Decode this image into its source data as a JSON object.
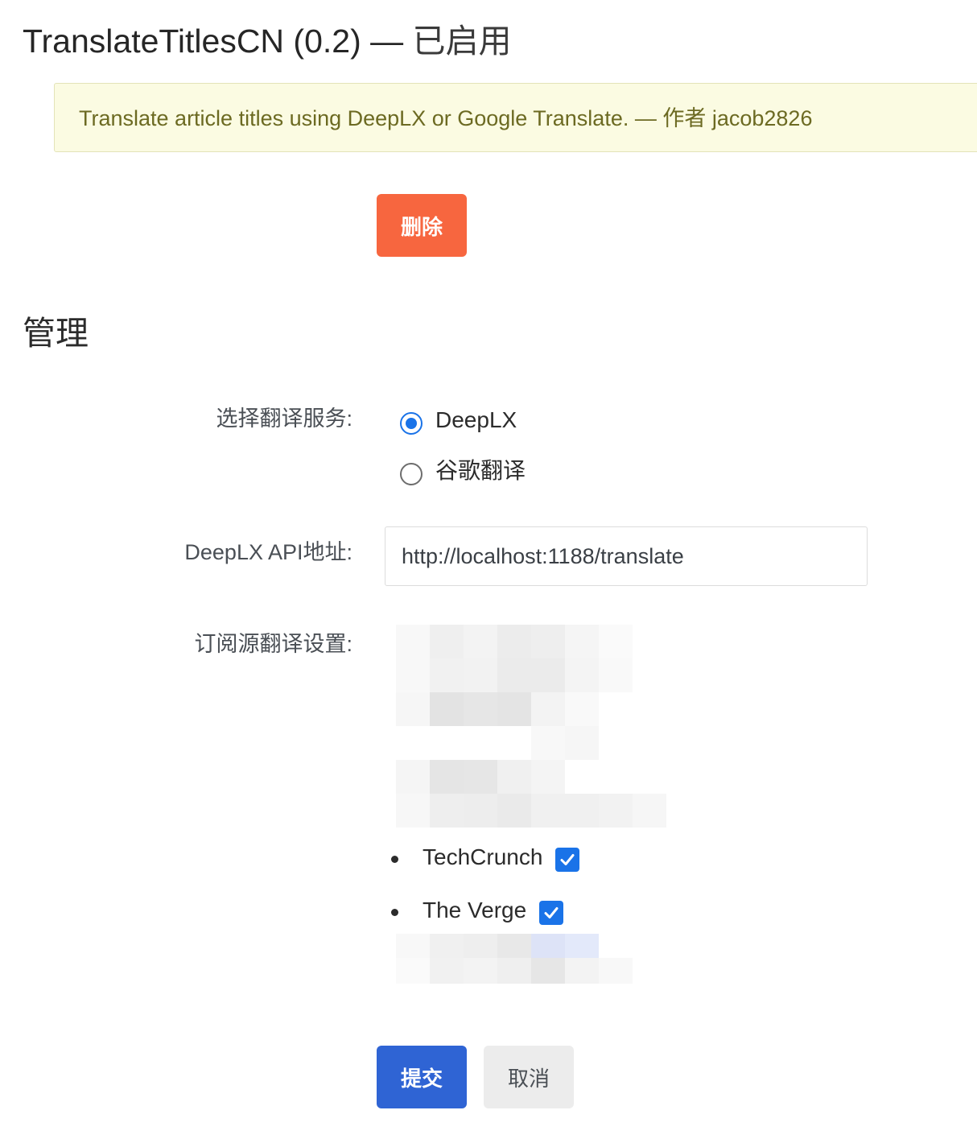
{
  "extension": {
    "name": "TranslateTitlesCN (0.2)",
    "separator": "—",
    "state": "已启用",
    "description": "Translate article titles using DeepLX or Google Translate. — 作者 jacob2826"
  },
  "actions": {
    "delete_label": "删除",
    "submit_label": "提交",
    "cancel_label": "取消"
  },
  "manage": {
    "title": "管理",
    "service_label": "选择翻译服务:",
    "services": [
      {
        "label": "DeepLX",
        "checked": true
      },
      {
        "label": "谷歌翻译",
        "checked": false
      }
    ],
    "api_label": "DeepLX API地址:",
    "api_value": "http://localhost:1188/translate",
    "feeds_label": "订阅源翻译设置:",
    "feeds": [
      {
        "name": "TechCrunch",
        "checked": true
      },
      {
        "name": "The Verge",
        "checked": true
      }
    ]
  },
  "colors": {
    "delete_button": "#f7663f",
    "submit_button": "#2f64d4",
    "accent": "#1a73e8",
    "notice_bg": "#fbfbe2",
    "notice_text": "#6c6a22"
  }
}
